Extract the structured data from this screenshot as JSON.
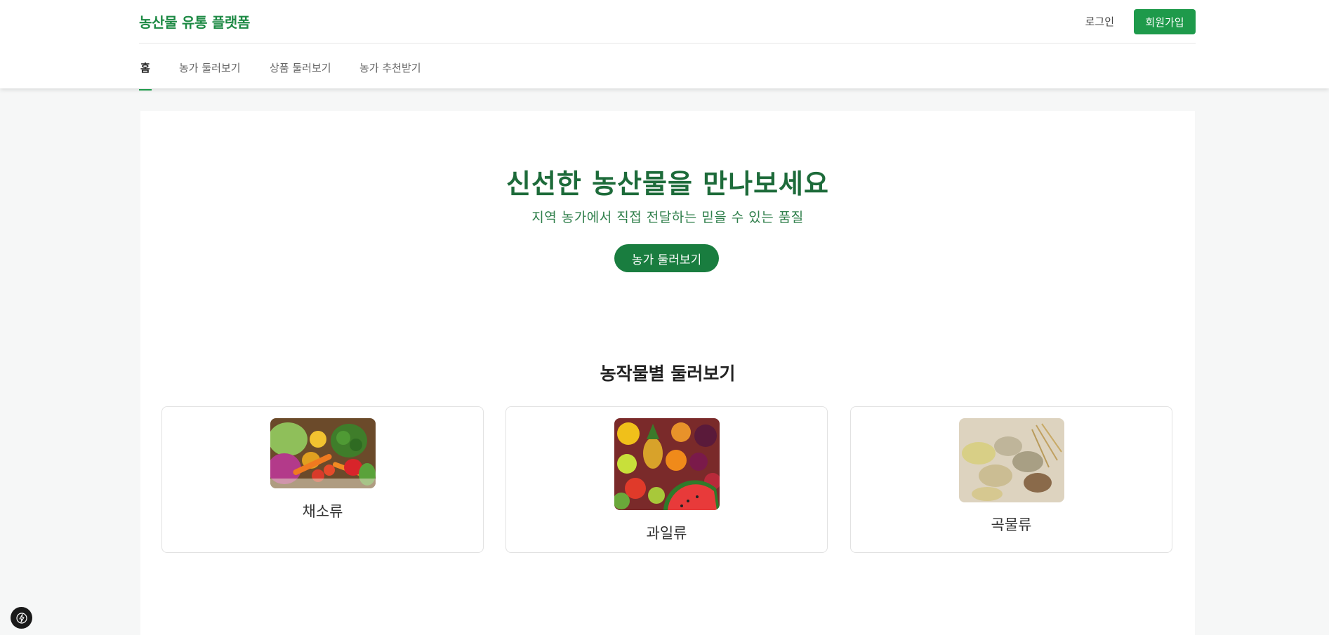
{
  "header": {
    "logo": "농산물 유통 플랫폼",
    "login": "로그인",
    "signup": "회원가입"
  },
  "nav": {
    "items": [
      {
        "label": "홈",
        "active": true
      },
      {
        "label": "농가 둘러보기",
        "active": false
      },
      {
        "label": "상품 둘러보기",
        "active": false
      },
      {
        "label": "농가 추천받기",
        "active": false
      }
    ]
  },
  "hero": {
    "title": "신선한 농산물을 만나보세요",
    "subtitle": "지역 농가에서 직접 전달하는 믿을 수 있는 품질",
    "button": "농가 둘러보기"
  },
  "categories": {
    "title": "농작물별 둘러보기",
    "items": [
      {
        "label": "채소류",
        "icon": "vegetables-image"
      },
      {
        "label": "과일류",
        "icon": "fruits-image"
      },
      {
        "label": "곡물류",
        "icon": "grains-image"
      }
    ]
  },
  "colors": {
    "brand": "#1e8a45",
    "button": "#1e9a4b",
    "hero_title": "#1d6b3a"
  },
  "floating": {
    "icon": "lightning-icon"
  }
}
